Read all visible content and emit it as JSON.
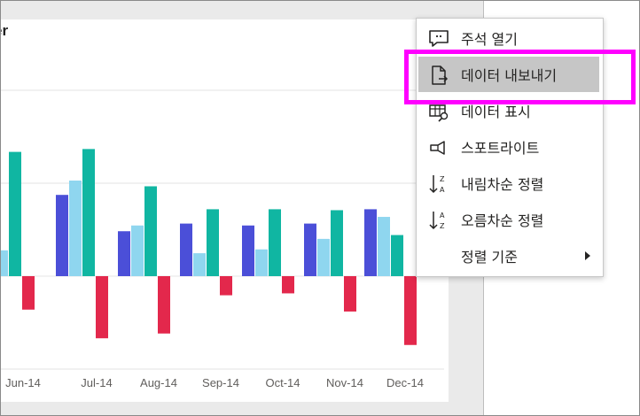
{
  "visual": {
    "title_fragment": "er"
  },
  "chart_data": {
    "type": "bar",
    "categories": [
      "Jun-14",
      "Jul-14",
      "Aug-14",
      "Sep-14",
      "Oct-14",
      "Nov-14",
      "Dec-14"
    ],
    "series": [
      {
        "values": [
          0.7,
          8.5,
          4.7,
          5.5,
          5.3,
          5.5,
          7.0
        ],
        "color": "#4b4fd8"
      },
      {
        "values": [
          2.7,
          10.0,
          5.3,
          2.4,
          2.8,
          3.9,
          6.2
        ],
        "color": "#8fd6ef"
      },
      {
        "values": [
          13.0,
          13.3,
          9.4,
          7.0,
          7.0,
          6.9,
          4.3
        ],
        "color": "#10b6a2"
      },
      {
        "values": [
          -3.5,
          -6.5,
          -6.0,
          -2.0,
          -1.8,
          -3.7,
          -7.2
        ],
        "color": "#e3284c"
      }
    ],
    "first_category_partial": true,
    "grid": true,
    "ylim": [
      -9,
      19
    ]
  },
  "context_menu": {
    "items": [
      {
        "label": "주석 열기",
        "icon": "comment-icon"
      },
      {
        "label": "데이터 내보내기",
        "icon": "export-file-icon",
        "active": true
      },
      {
        "label": "데이터 표시",
        "icon": "data-table-icon"
      },
      {
        "label": "스포트라이트",
        "icon": "spotlight-icon"
      },
      {
        "label": "내림차순 정렬",
        "icon": "sort-descending-icon"
      },
      {
        "label": "오름차순 정렬",
        "icon": "sort-ascending-icon"
      },
      {
        "label": "정렬 기준",
        "icon": "",
        "submenu": true
      }
    ]
  },
  "colors": {
    "highlight": "#ff00ff",
    "active_item_bg": "#c6c6c6"
  }
}
